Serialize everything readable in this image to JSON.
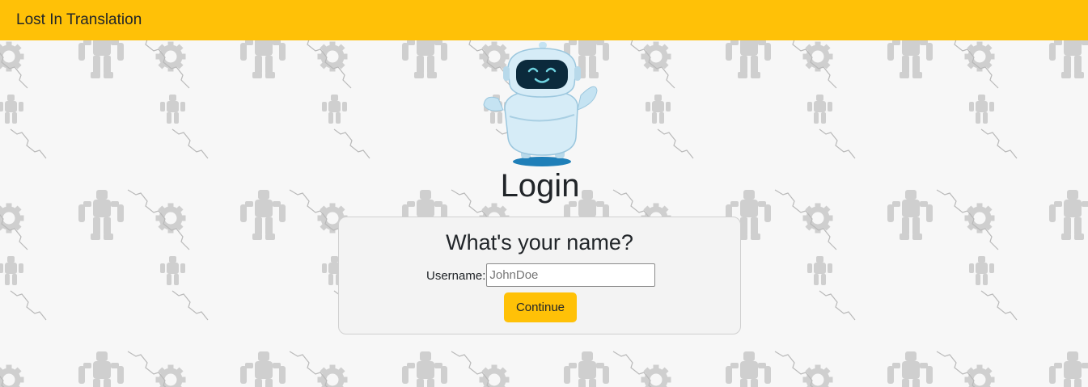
{
  "navbar": {
    "brand": "Lost In Translation"
  },
  "login": {
    "title": "Login",
    "card_title": "What's your name?",
    "username_label": "Username:",
    "username_value": "",
    "username_placeholder": "JohnDoe",
    "continue_label": "Continue"
  },
  "colors": {
    "accent": "#ffc107",
    "background": "#f7f7f7",
    "card_background": "#f3f3f3",
    "pattern": "#cfcfcf",
    "robot_body": "#c5e3f2",
    "robot_face": "#0b2a3c",
    "robot_shadow": "#1f7fb8"
  },
  "icons": {
    "mascot": "robot-mascot-icon",
    "pattern_robot": "robot-silhouette-icon",
    "pattern_gear": "gear-icon"
  }
}
